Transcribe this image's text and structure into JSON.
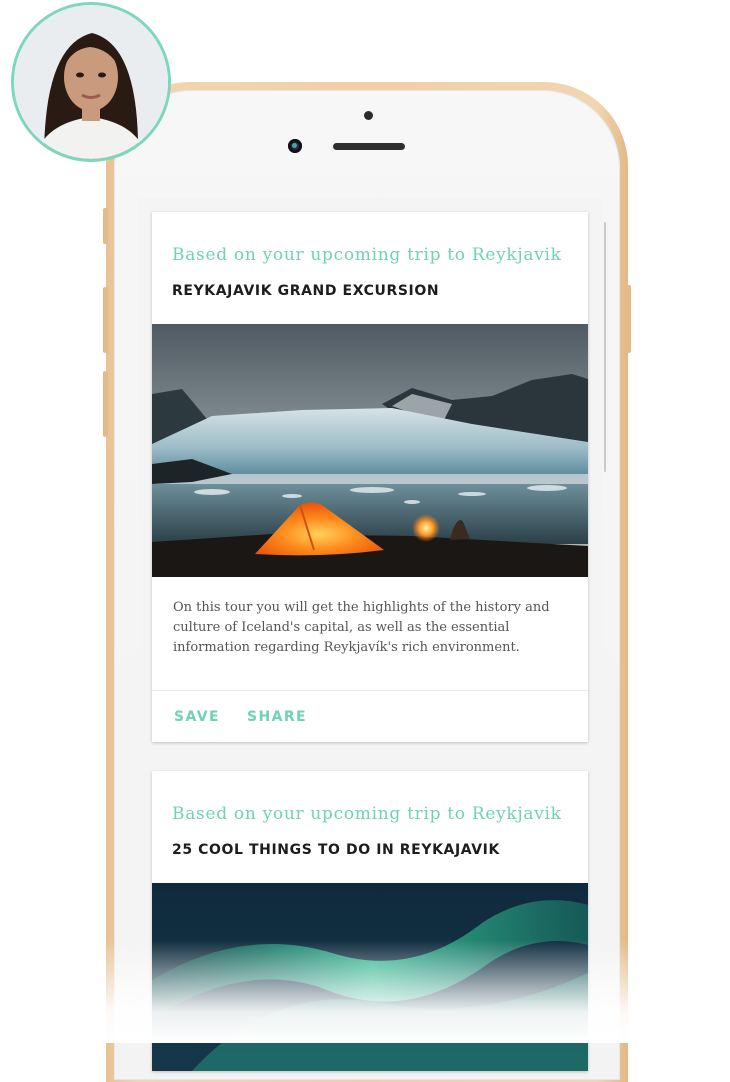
{
  "colors": {
    "accent": "#6fd1b7",
    "phone_gold": "#efcfa6",
    "title": "#1d1d1d"
  },
  "profile": {
    "icon": "user-avatar"
  },
  "cards": [
    {
      "subtitle": "Based on your upcoming trip to Reykjavik",
      "title": "REYKAJAVIK GRAND EXCURSION",
      "image": "glacier-lagoon-tent-photo",
      "description": "On this tour you will get the highlights of the history and culture of Iceland's capital, as well as the essential information regarding Reykjavík's rich environment.",
      "actions": {
        "save": "SAVE",
        "share": "SHARE"
      }
    },
    {
      "subtitle": "Based on your upcoming trip to Reykjavik",
      "title": "25 COOL THINGS TO DO IN REYKAJAVIK",
      "image": "northern-lights-photo"
    }
  ]
}
